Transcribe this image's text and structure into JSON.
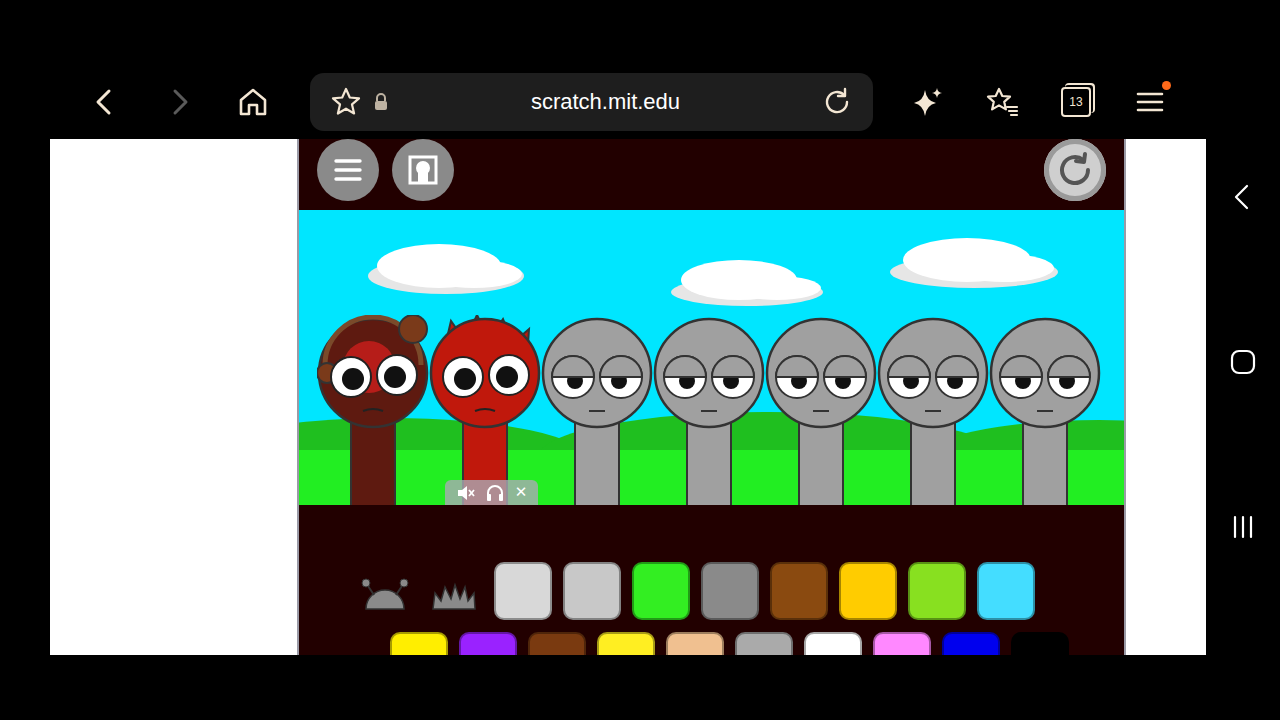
{
  "browser": {
    "url": "scratch.mit.edu",
    "tab_count": "13",
    "forward_disabled": true,
    "menu_badge": true
  },
  "game": {
    "characters": [
      {
        "kind": "headphones",
        "awake": true,
        "color": "#5e1a10"
      },
      {
        "kind": "spiky",
        "awake": true,
        "color": "#c0180c"
      },
      {
        "kind": "plain",
        "awake": false,
        "color": "#a0a0a0"
      },
      {
        "kind": "plain",
        "awake": false,
        "color": "#a0a0a0"
      },
      {
        "kind": "plain",
        "awake": false,
        "color": "#a0a0a0"
      },
      {
        "kind": "plain",
        "awake": false,
        "color": "#a0a0a0"
      },
      {
        "kind": "plain",
        "awake": false,
        "color": "#a0a0a0"
      }
    ],
    "overlay": {
      "close": "✕"
    },
    "palette_row1": [
      {
        "kind": "dome",
        "color": "#8a8a8a"
      },
      {
        "kind": "spikes",
        "color": "#8a8a8a"
      },
      {
        "kind": "tile",
        "color": "#d8d8d8"
      },
      {
        "kind": "tile",
        "color": "#c8c8c8"
      },
      {
        "kind": "tile",
        "color": "#33ee22"
      },
      {
        "kind": "tile",
        "color": "#8a8a8a"
      },
      {
        "kind": "tile",
        "color": "#8a4a10"
      },
      {
        "kind": "tile",
        "color": "#ffcc00"
      },
      {
        "kind": "tile",
        "color": "#88e020"
      },
      {
        "kind": "tile",
        "color": "#44ddff"
      }
    ],
    "palette_row2": [
      {
        "kind": "tile",
        "color": "#ffee00"
      },
      {
        "kind": "tile",
        "color": "#9a22ff"
      },
      {
        "kind": "tile",
        "color": "#7a3a10"
      },
      {
        "kind": "tile",
        "color": "#ffee22"
      },
      {
        "kind": "tile",
        "color": "#f0c090"
      },
      {
        "kind": "tile",
        "color": "#aaaaaa"
      },
      {
        "kind": "tile",
        "color": "#ffffff"
      },
      {
        "kind": "tile",
        "color": "#ff88ff"
      },
      {
        "kind": "tile",
        "color": "#0000ee"
      },
      {
        "kind": "tile",
        "color": "#000000"
      }
    ]
  }
}
